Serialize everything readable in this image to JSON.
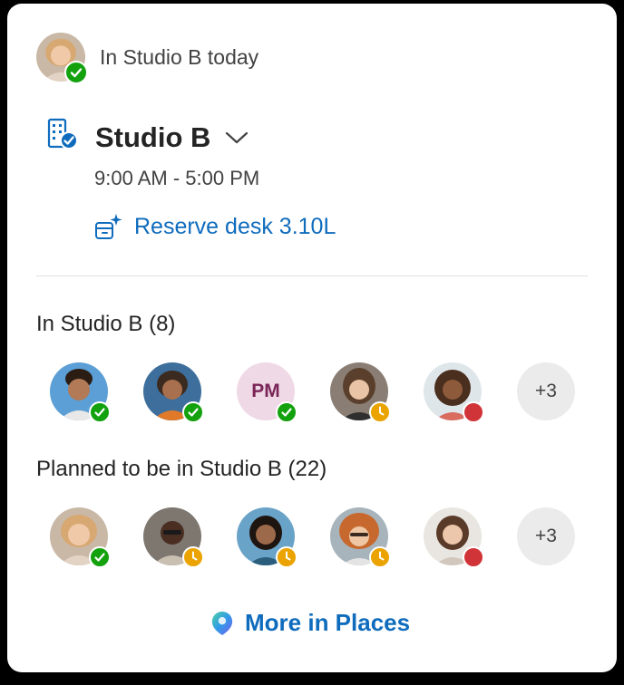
{
  "header": {
    "status_text": "In Studio B today"
  },
  "location": {
    "name": "Studio B",
    "hours": "9:00 AM - 5:00 PM",
    "reserve_label": "Reserve desk 3.10L"
  },
  "sections": [
    {
      "title": "In Studio B (8)",
      "people": [
        {
          "type": "photo",
          "status": "available"
        },
        {
          "type": "photo",
          "status": "available"
        },
        {
          "type": "initials",
          "initials": "PM",
          "status": "available"
        },
        {
          "type": "photo",
          "status": "away"
        },
        {
          "type": "photo",
          "status": "busy"
        },
        {
          "type": "more",
          "label": "+3"
        }
      ]
    },
    {
      "title": "Planned to be in Studio B (22)",
      "people": [
        {
          "type": "photo",
          "status": "available"
        },
        {
          "type": "photo",
          "status": "away"
        },
        {
          "type": "photo",
          "status": "away"
        },
        {
          "type": "photo",
          "status": "away"
        },
        {
          "type": "photo",
          "status": "busy"
        },
        {
          "type": "more",
          "label": "+3"
        }
      ]
    }
  ],
  "footer": {
    "more_places_label": "More in Places"
  },
  "colors": {
    "accent": "#0f6cbd",
    "available": "#13a10e",
    "away": "#eaa300",
    "busy": "#d13438"
  }
}
